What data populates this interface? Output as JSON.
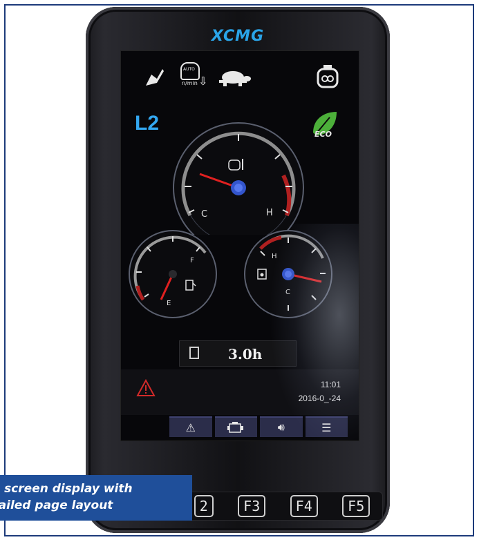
{
  "brand": "XCMG",
  "screen": {
    "level_indicator": "L2",
    "eco_label": "ECO",
    "top_icons": {
      "auto_rpm_text": "AUTO",
      "auto_rpm_unit": "n/min"
    },
    "coolant_gauge": {
      "cold_label": "C",
      "hot_label": "H",
      "level": 0.35
    },
    "fuel_gauge": {
      "empty_label": "E",
      "full_label": "F",
      "level": 0.15
    },
    "oil_temp_gauge": {
      "cold_label": "C",
      "hot_label": "H",
      "level": 0.45
    },
    "hour_meter": "3.0h",
    "time": "11:01",
    "date": "2016-0_-24",
    "colors": {
      "accent_blue": "#33a7f0",
      "eco_green": "#4caf3a",
      "needle_red": "#e02020",
      "warn_red": "#d42a2a"
    }
  },
  "function_keys": [
    "2",
    "F3",
    "F4",
    "F5"
  ],
  "caption": {
    "line1": "ch screen display with",
    "line2": "etailed page layout"
  }
}
